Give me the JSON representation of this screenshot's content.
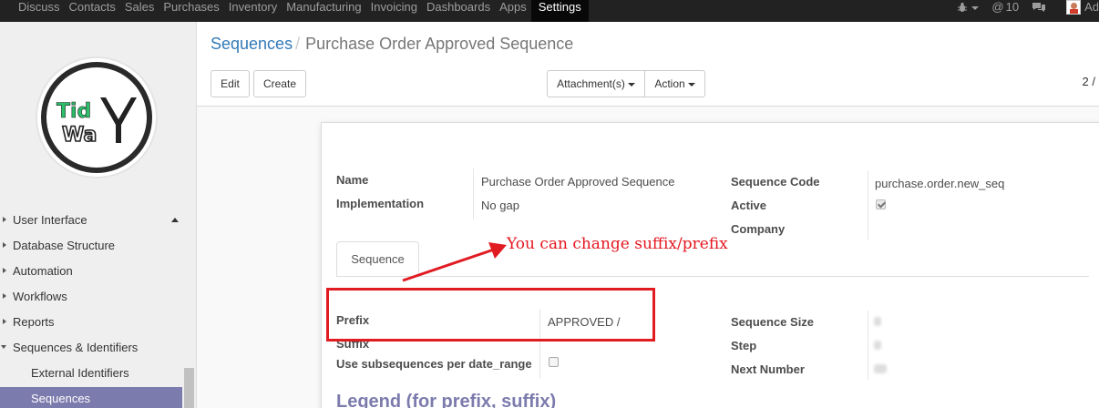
{
  "topbar": {
    "menu": [
      "Discuss",
      "Contacts",
      "Sales",
      "Purchases",
      "Inventory",
      "Manufacturing",
      "Invoicing",
      "Dashboards",
      "Apps",
      "Settings"
    ],
    "active": "Settings",
    "messages_count": "10",
    "user_short": "Ad",
    "icons": [
      "bug-icon",
      "at-icon",
      "chat-icon",
      "avatar"
    ]
  },
  "sidebar": {
    "logo_text_top": "Tid",
    "logo_text_bottom": "WaY",
    "items": [
      {
        "label": "User Interface",
        "expanded": false
      },
      {
        "label": "Database Structure",
        "expanded": false
      },
      {
        "label": "Automation",
        "expanded": false
      },
      {
        "label": "Workflows",
        "expanded": false
      },
      {
        "label": "Reports",
        "expanded": false
      },
      {
        "label": "Sequences & Identifiers",
        "expanded": true
      },
      {
        "label": "External Identifiers",
        "sub": true
      },
      {
        "label": "Sequences",
        "sub": true,
        "selected": true
      }
    ]
  },
  "control": {
    "breadcrumb_parent": "Sequences",
    "breadcrumb_sep": "/",
    "breadcrumb_current": "Purchase Order Approved Sequence",
    "edit_label": "Edit",
    "create_label": "Create",
    "attachments_label": "Attachment(s)",
    "action_label": "Action",
    "pager": "2 /"
  },
  "form": {
    "name_label": "Name",
    "name_value": "Purchase Order Approved Sequence",
    "implementation_label": "Implementation",
    "implementation_value": "No gap",
    "sequence_code_label": "Sequence Code",
    "sequence_code_value": "purchase.order.new_seq",
    "active_label": "Active",
    "active_value": true,
    "company_label": "Company",
    "tab_label": "Sequence",
    "prefix_label": "Prefix",
    "prefix_value": "APPROVED /",
    "suffix_label": "Suffix",
    "subsequences_label": "Use subsequences per date_range",
    "subsequences_value": false,
    "sequence_size_label": "Sequence Size",
    "step_label": "Step",
    "next_number_label": "Next Number",
    "legend_heading": "Legend (for prefix, suffix)"
  },
  "annotation": {
    "text": "You can change suffix/prefix",
    "color": "#e4161f"
  },
  "colors": {
    "accent": "#7c7bad",
    "link": "#337ab7",
    "topbar": "#222222"
  }
}
